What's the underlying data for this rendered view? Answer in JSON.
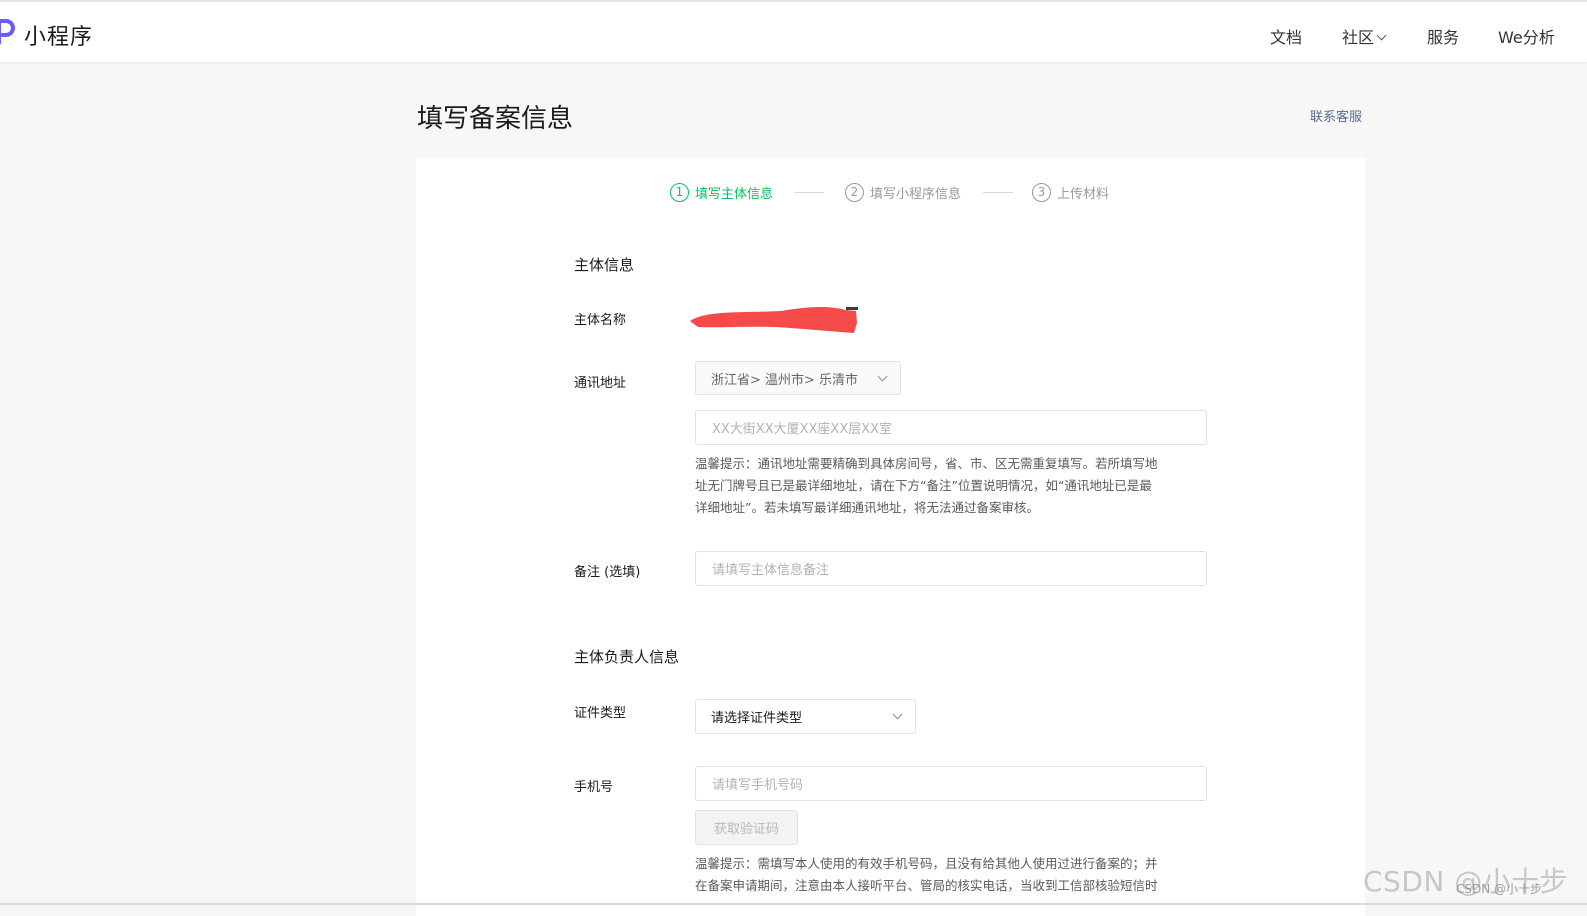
{
  "header": {
    "logo_text": "小程序",
    "nav": [
      {
        "label": "文档",
        "has_dropdown": false
      },
      {
        "label": "社区",
        "has_dropdown": true
      },
      {
        "label": "服务",
        "has_dropdown": false
      },
      {
        "label": "We分析",
        "has_dropdown": false
      }
    ]
  },
  "page": {
    "title": "填写备案信息",
    "contact_link": "联系客服"
  },
  "steps": [
    {
      "number": "1",
      "label": "填写主体信息",
      "active": true
    },
    {
      "number": "2",
      "label": "填写小程序信息",
      "active": false
    },
    {
      "number": "3",
      "label": "上传材料",
      "active": false
    }
  ],
  "subject_info": {
    "section_title": "主体信息",
    "name_label": "主体名称",
    "address_label": "通讯地址",
    "address_region": "浙江省> 温州市> 乐清市",
    "address_detail_placeholder": "XX大街XX大厦XX座XX层XX室",
    "address_hint": [
      "温馨提示：通讯地址需要精确到具体房间号，省、市、区无需重复填写。若所填写地",
      "址无门牌号且已是最详细地址，请在下方“备注”位置说明情况，如“通讯地址已是最",
      "详细地址”。若未填写最详细通讯地址，将无法通过备案审核。"
    ],
    "remark_label": "备注 (选填)",
    "remark_placeholder": "请填写主体信息备注"
  },
  "principal_info": {
    "section_title": "主体负责人信息",
    "id_type_label": "证件类型",
    "id_type_placeholder": "请选择证件类型",
    "phone_label": "手机号",
    "phone_placeholder": "请填写手机号码",
    "get_code_button": "获取验证码",
    "phone_hint": [
      "温馨提示：需填写本人使用的有效手机号码，且没有给其他人使用过进行备案的；并",
      "在备案申请期间，注意由本人接听平台、管局的核实电话，当收到工信部核验短信时"
    ]
  },
  "watermark": {
    "large": "CSDN @小十步",
    "small": "CSDN @小十步"
  },
  "colors": {
    "accent_green": "#07c160",
    "link_blue": "#576b95",
    "redaction": "#f44a4a",
    "logo_purple": "#6a5cf6"
  }
}
